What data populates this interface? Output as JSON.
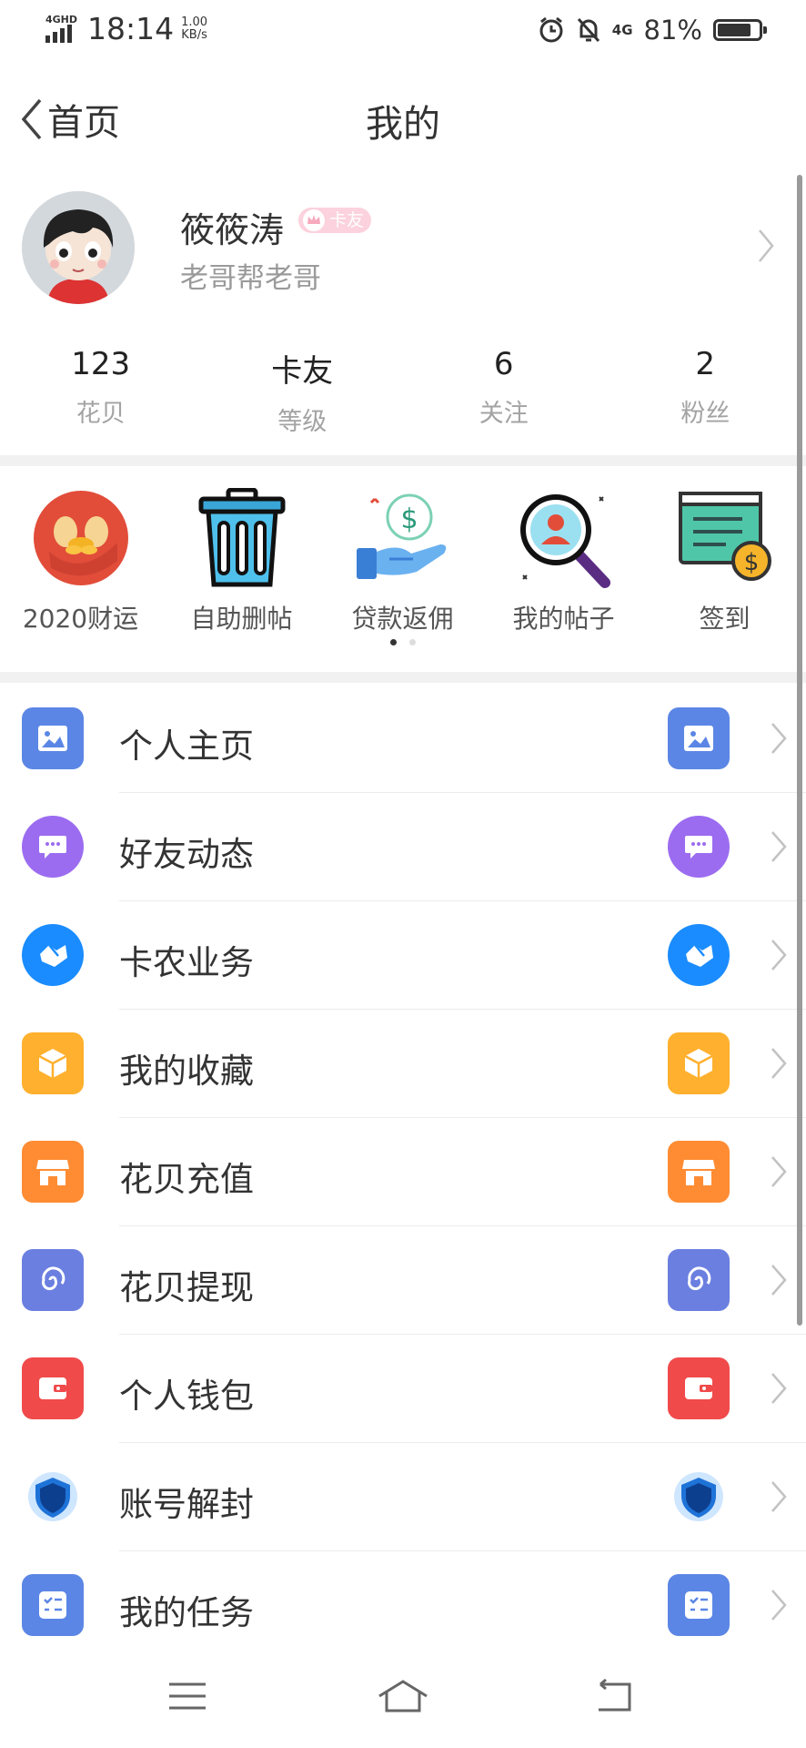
{
  "status_bar": {
    "network": "4GHD",
    "time": "18:14",
    "speed_value": "1.00",
    "speed_unit": "KB/s",
    "right_network": "4G",
    "battery_percent": "81%",
    "battery_level": 0.81
  },
  "nav": {
    "back_label": "首页",
    "title": "我的"
  },
  "profile": {
    "nickname": "筱筱涛",
    "badge": "卡友",
    "signature": "老哥帮老哥"
  },
  "stats": [
    {
      "value": "123",
      "label": "花贝"
    },
    {
      "value": "卡友",
      "label": "等级"
    },
    {
      "value": "6",
      "label": "关注"
    },
    {
      "value": "2",
      "label": "粉丝"
    }
  ],
  "shortcuts": [
    {
      "label": "2020财运",
      "icon": "fortune-icon"
    },
    {
      "label": "自助删帖",
      "icon": "trash-icon"
    },
    {
      "label": "贷款返佣",
      "icon": "money-hand-icon"
    },
    {
      "label": "我的帖子",
      "icon": "search-user-icon"
    },
    {
      "label": "签到",
      "icon": "checkin-icon"
    }
  ],
  "carousel": {
    "pages": 2,
    "active_page": 1
  },
  "menu": [
    {
      "label": "个人主页",
      "icon": "image-icon",
      "color": "#5b86e5"
    },
    {
      "label": "好友动态",
      "icon": "chat-bubble-icon",
      "color": "#9b6cf0"
    },
    {
      "label": "卡农业务",
      "icon": "handshake-icon",
      "color": "#1a8cff"
    },
    {
      "label": "我的收藏",
      "icon": "box-icon",
      "color": "#ffb02e"
    },
    {
      "label": "花贝充值",
      "icon": "store-icon",
      "color": "#ff8c33"
    },
    {
      "label": "花贝提现",
      "icon": "spiral-icon",
      "color": "#6b7fe0"
    },
    {
      "label": "个人钱包",
      "icon": "wallet-icon",
      "color": "#f04a4a"
    },
    {
      "label": "账号解封",
      "icon": "shield-icon",
      "color": "#1e73d8"
    },
    {
      "label": "我的任务",
      "icon": "task-list-icon",
      "color": "#5b86e5"
    }
  ]
}
